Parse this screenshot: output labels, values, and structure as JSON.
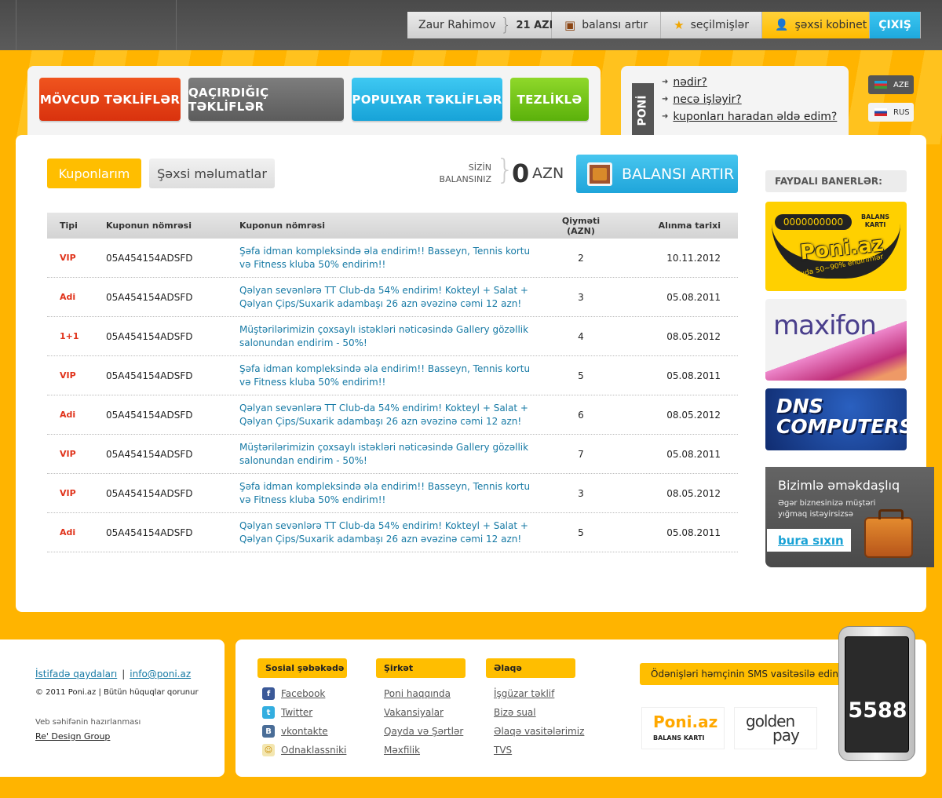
{
  "topbar": {
    "user_name": "Zaur Rahimov",
    "user_balance": "21 AZN",
    "topup_label": "balansı artır",
    "favorites_label": "seçilmişlər",
    "cabinet_label": "şəxsi kobinet",
    "exit_label": "ÇIXIŞ"
  },
  "categories": [
    {
      "label": "MÖVCUD TƏKLİFLƏR"
    },
    {
      "label": "QAÇIRDIĞIÇ TƏKLİFLƏR"
    },
    {
      "label": "POPULYAR TƏKLİFLƏR"
    },
    {
      "label": "TEZLİKLƏ"
    }
  ],
  "poni": {
    "tag": "PONİ",
    "links": [
      "nədir?",
      "necə işləyir?",
      "kuponları haradan əldə edim?"
    ]
  },
  "languages": {
    "aze": "AZE",
    "rus": "RUS"
  },
  "account": {
    "tab_coupons": "Kuponlarım",
    "tab_personal": "Şəxsi məlumatlar",
    "balance_label_1": "SİZİN",
    "balance_label_2": "BALANSINIZ",
    "balance_value": "0",
    "balance_currency": "AZN",
    "topup_button": "BALANSI ARTIR"
  },
  "table": {
    "headers": [
      "Tipi",
      "Kuponun nömrəsi",
      "Kuponun nömrəsi",
      "Qiymәti (AZN)",
      "Alınma tarixi"
    ],
    "rows": [
      {
        "type": "VIP",
        "code": "05A454154ADSFD",
        "desc": "Şəfa idman kompleksində əla endirim!! Basseyn, Tennis kortu və Fitness kluba 50% endirim!!",
        "price": "2",
        "date": "10.11.2012"
      },
      {
        "type": "Adi",
        "code": "05A454154ADSFD",
        "desc": "Qəlyan sevənlərə TT Club-da 54% endirim! Kokteyl + Salat + Qəlyan Çips/Suxarik adambaşı 26 azn əvəzinə cəmi 12 azn!",
        "price": "3",
        "date": "05.08.2011"
      },
      {
        "type": "1+1",
        "code": "05A454154ADSFD",
        "desc": "Müştərilərimizin çoxsaylı istəkləri nəticəsində Gallery gözəllik salonundan endirim - 50%!",
        "price": "4",
        "date": "08.05.2012"
      },
      {
        "type": "VIP",
        "code": "05A454154ADSFD",
        "desc": "Şəfa idman kompleksində əla endirim!! Basseyn, Tennis kortu və Fitness kluba 50% endirim!!",
        "price": "5",
        "date": "05.08.2011"
      },
      {
        "type": "Adi",
        "code": "05A454154ADSFD",
        "desc": "Qəlyan sevənlərə TT Club-da 54% endirim! Kokteyl + Salat + Qəlyan Çips/Suxarik adambaşı 26 azn əvəzinə cəmi 12 azn!",
        "price": "6",
        "date": "08.05.2012"
      },
      {
        "type": "VIP",
        "code": "05A454154ADSFD",
        "desc": "Müştərilərimizin çoxsaylı istəkləri nəticəsində Gallery gözəllik salonundan endirim - 50%!",
        "price": "7",
        "date": "05.08.2011"
      },
      {
        "type": "VIP",
        "code": "05A454154ADSFD",
        "desc": "Şəfa idman kompleksində əla endirim!! Basseyn, Tennis kortu və Fitness kluba 50% endirim!!",
        "price": "3",
        "date": "08.05.2012"
      },
      {
        "type": "Adi",
        "code": "05A454154ADSFD",
        "desc": "Qəlyan sevənlərə TT Club-da 54% endirim! Kokteyl + Salat + Qəlyan Çips/Suxarik adambaşı 26 azn əvəzinə cəmi 12 azn!",
        "price": "5",
        "date": "05.08.2011"
      }
    ]
  },
  "sidebar": {
    "banners_title": "FAYDALI BANERLƏR:",
    "poni_banner": {
      "number": "0000000000",
      "tag1": "BALANS",
      "tag2": "KARTI",
      "logo": "Poni.az",
      "slogan": "Bakıda 50~90% endirimlər"
    },
    "maxifon_banner": "maxifon",
    "dns_banner": {
      "line1": "DNS",
      "line2": "COMPUTERS"
    },
    "cooperation": {
      "title": "Bizimlə əməkdaşlıq",
      "text": "Əgər biznesinizə müştəri yığmaq istəyirsizsə",
      "link": "bura sıxın"
    }
  },
  "footer": {
    "terms": "İstifadə qaydaları",
    "email": "info@poni.az",
    "copyright": "© 2011 Poni.az  |  Bütün hüquqlar qorunur",
    "made_by_label": "Veb səhifənin hazırlanması",
    "made_by": "Re' Design Group",
    "social": {
      "title": "Sosial şəbəkədə",
      "items": [
        "Facebook",
        "Twitter",
        "vkontakte",
        "Odnaklassniki"
      ]
    },
    "company": {
      "title": "Şirkət",
      "items": [
        "Poni haqqında",
        "Vakansiyalar",
        "Qayda və Şərtlər",
        "Məxfilik"
      ]
    },
    "contact": {
      "title": "Əlaqə",
      "items": [
        "İşgüzar təklif",
        "Bizə sual",
        "Əlaqə vasitələrimiz",
        "TVS"
      ]
    },
    "sms_text": "Ödənişləri həmçinin SMS vasitəsilə edin!",
    "poni_logo": "Poni.az",
    "poni_logo_sub": "BALANS KARTI",
    "goldenpay_1": "golden",
    "goldenpay_2": "pay",
    "sms_number": "5588"
  },
  "colors": {
    "accent": "#ffb400",
    "red": "#e0331b",
    "blue": "#1fa5da",
    "link": "#177aa5"
  }
}
